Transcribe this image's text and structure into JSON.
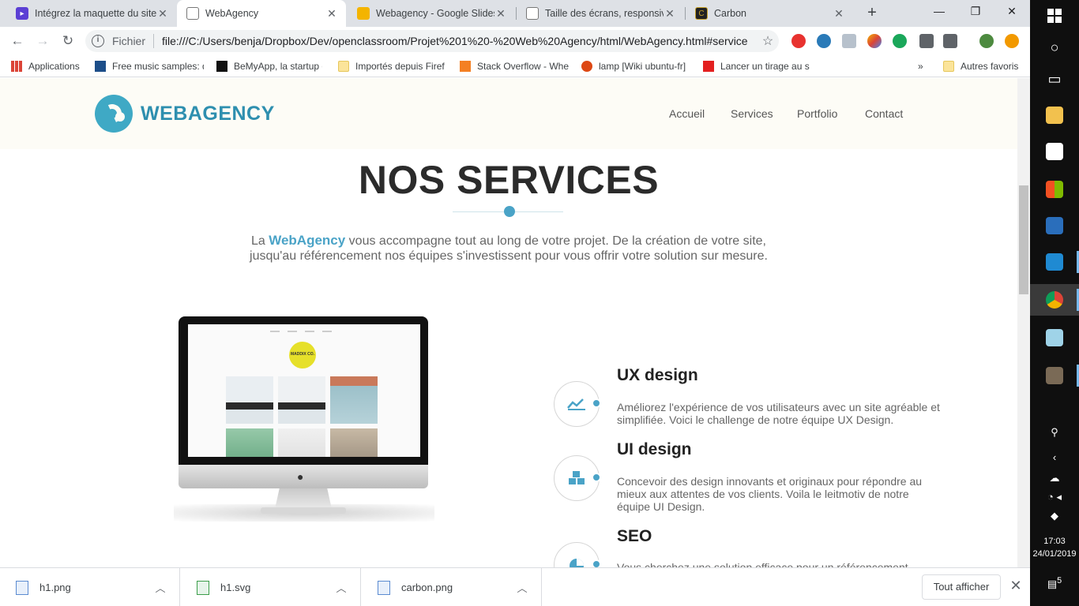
{
  "browser": {
    "tabs": [
      {
        "title": "Intégrez la maquette du site",
        "favicon_color": "#5b3fd4",
        "active": false
      },
      {
        "title": "WebAgency",
        "favicon_color": "#ffffff",
        "active": true
      },
      {
        "title": "Webagency - Google Slides",
        "favicon_color": "#f4b400",
        "active": false
      },
      {
        "title": "Taille des écrans, responsive",
        "favicon_color": "#ffffff",
        "active": false
      },
      {
        "title": "Carbon",
        "favicon_color": "#222222",
        "active": false
      }
    ],
    "address": {
      "scheme": "Fichier",
      "url": "file:///C:/Users/benja/Dropbox/Dev/openclassroom/Projet%201%20-%20Web%20Agency/html/WebAgency.html#service"
    },
    "bookmarks": [
      {
        "label": "Applications",
        "icon": "apps-grid-icon"
      },
      {
        "label": "Free music samples: d",
        "icon": "mr-icon"
      },
      {
        "label": "BeMyApp, la startup d",
        "icon": "medium-icon"
      },
      {
        "label": "Importés depuis Firef",
        "icon": "folder-icon"
      },
      {
        "label": "Stack Overflow - Whe",
        "icon": "stackoverflow-icon"
      },
      {
        "label": "lamp [Wiki ubuntu-fr]",
        "icon": "ubuntu-icon"
      },
      {
        "label": "Lancer un tirage au s",
        "icon": "gift-icon"
      }
    ],
    "bookmarks_more": "»",
    "other_bookmarks": "Autres favoris"
  },
  "site": {
    "logo_text": "WEBAGENCY",
    "nav": [
      "Accueil",
      "Services",
      "Portfolio",
      "Contact"
    ],
    "section_title": "NOS SERVICES",
    "intro_pre": "La ",
    "intro_brand": "WebAgency",
    "intro_post": " vous accompagne tout au long de votre projet. De la création de votre site, jusqu'au référencement nos équipes s'investissent pour vous offrir votre solution sur mesure.",
    "mockup_logo": "MADDIX CO.",
    "services": [
      {
        "title": "UX design",
        "desc": "Améliorez l'expérience de vos utilisateurs avec un site agréable et simplifiée. Voici le challenge de notre équipe UX Design.",
        "icon": "chart-icon"
      },
      {
        "title": "UI design",
        "desc": "Concevoir des design innovants et originaux pour répondre au mieux aux attentes de vos clients. Voila le leitmotiv de notre équipe UI Design.",
        "icon": "cubes-icon"
      },
      {
        "title": "SEO",
        "desc": "Vous cherchez une solution efficace pour un référencement",
        "icon": "pie-chart-icon"
      }
    ],
    "accent_color": "#4aa3c7"
  },
  "downloads": {
    "items": [
      {
        "name": "h1.png"
      },
      {
        "name": "h1.svg"
      },
      {
        "name": "carbon.png"
      }
    ],
    "show_all": "Tout afficher"
  },
  "taskbar": {
    "time": "17:03",
    "date": "24/01/2019",
    "notifications": "5"
  }
}
